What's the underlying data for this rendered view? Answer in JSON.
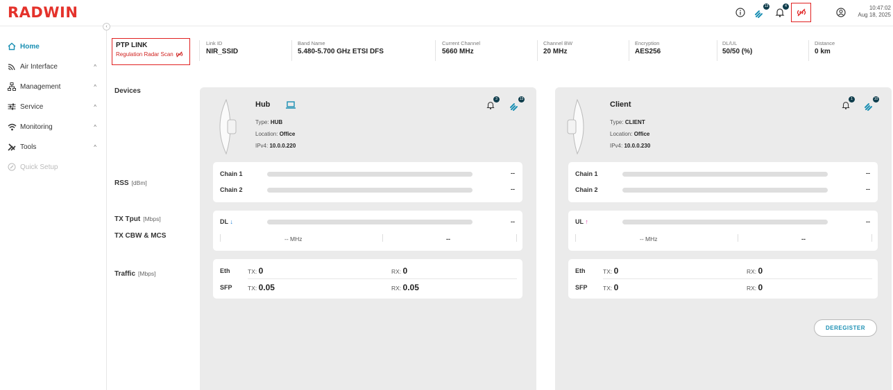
{
  "header": {
    "brand": "RADWIN",
    "notif_badges": [
      "13",
      "4"
    ],
    "time": "10:47:02",
    "date": "Aug 18, 2025"
  },
  "sidebar": {
    "collapse_icon": "chevron-left-icon",
    "items": [
      {
        "label": "Home",
        "icon": "home-icon",
        "state": "active"
      },
      {
        "label": "Air Interface",
        "icon": "wifi-icon"
      },
      {
        "label": "Management",
        "icon": "sitemap-icon"
      },
      {
        "label": "Service",
        "icon": "sliders-icon"
      },
      {
        "label": "Monitoring",
        "icon": "signal-icon"
      },
      {
        "label": "Tools",
        "icon": "tools-icon"
      },
      {
        "label": "Quick Setup",
        "icon": "magic-icon",
        "state": "disabled"
      }
    ]
  },
  "link": {
    "title": "PTP LINK",
    "status": "Regulation Radar Scan",
    "fields": [
      {
        "label": "Link ID",
        "value": "NIR_SSID"
      },
      {
        "label": "Band Name",
        "value": "5.480-5.700 GHz ETSI DFS"
      },
      {
        "label": "Current Channel",
        "value": "5660 MHz"
      },
      {
        "label": "Channel BW",
        "value": "20 MHz"
      },
      {
        "label": "Encryption",
        "value": "AES256"
      },
      {
        "label": "DL/UL",
        "value": "50/50 (%)"
      },
      {
        "label": "Distance",
        "value": "0 km"
      }
    ]
  },
  "rows": {
    "devices": "Devices",
    "rss": "RSS",
    "rss_unit": "[dBm]",
    "tput": "TX Tput",
    "tput_unit": "[Mbps]",
    "cbw": "TX CBW & MCS",
    "traffic": "Traffic",
    "traffic_unit": "[Mbps]"
  },
  "hub": {
    "name": "Hub",
    "type_label": "Type:",
    "type": "HUB",
    "location_label": "Location:",
    "location": "Office",
    "ip_label": "IPv4:",
    "ip": "10.0.0.220",
    "badges": [
      "3",
      "13"
    ],
    "chain1": "Chain 1",
    "chain1_val": "--",
    "chain2": "Chain 2",
    "chain2_val": "--",
    "dir": "DL",
    "dir_val": "--",
    "cbw": "-- MHz",
    "mcs": "--",
    "eth": "Eth",
    "eth_tx_lbl": "TX:",
    "eth_tx": "0",
    "eth_rx_lbl": "RX:",
    "eth_rx": "0",
    "sfp": "SFP",
    "sfp_tx_lbl": "TX:",
    "sfp_tx": "0.05",
    "sfp_rx_lbl": "RX:",
    "sfp_rx": "0.05"
  },
  "client": {
    "name": "Client",
    "type_label": "Type:",
    "type": "CLIENT",
    "location_label": "Location:",
    "location": "Office",
    "ip_label": "IPv4:",
    "ip": "10.0.0.230",
    "badges": [
      "1",
      "10"
    ],
    "chain1": "Chain 1",
    "chain1_val": "--",
    "chain2": "Chain 2",
    "chain2_val": "--",
    "dir": "UL",
    "dir_val": "--",
    "cbw": "-- MHz",
    "mcs": "--",
    "eth": "Eth",
    "eth_tx_lbl": "TX:",
    "eth_tx": "0",
    "eth_rx_lbl": "RX:",
    "eth_rx": "0",
    "sfp": "SFP",
    "sfp_tx_lbl": "TX:",
    "sfp_tx": "0",
    "sfp_rx_lbl": "RX:",
    "sfp_rx": "0"
  },
  "actions": {
    "deregister": "DEREGISTER"
  },
  "colors": {
    "accent": "#1a8fb3",
    "brand": "#e4322b",
    "alert": "#e02020",
    "dl_arrow": "#1a7fd6",
    "ul_arrow": "#e040b0"
  }
}
